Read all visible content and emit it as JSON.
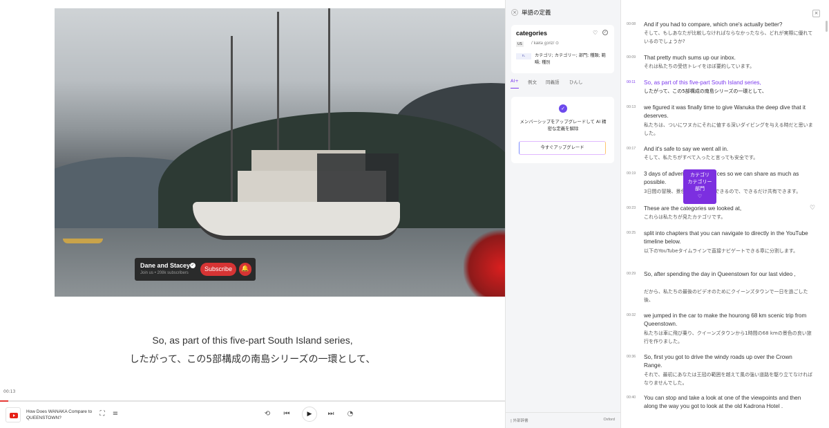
{
  "video": {
    "channel_name": "Dane and Stacey",
    "channel_sub": "Join us • 208k subscribers",
    "subscribe_label": "Subscribe",
    "check_glyph": "✓",
    "bell_glyph": "🔔"
  },
  "captions": {
    "english": "So, as part of this five-part South Island series,",
    "japanese": "したがって、この5部構成の南島シリーズの一環として、"
  },
  "player": {
    "time": "00:13",
    "progress_fraction": 0.016,
    "title": "How Does WANAKA Compare to QUEENSTOWN?",
    "icons": {
      "logo": "youtube-icon",
      "subtitle": "subtitle-icon",
      "add": "add-list-icon",
      "loop": "loop-icon",
      "prev": "skip-previous-icon",
      "play": "play-icon",
      "next": "skip-next-icon",
      "speed": "speed-icon"
    },
    "glyphs": {
      "subtitle": "⛶",
      "add": "≡",
      "loop": "⟲",
      "prev": "⏮",
      "play": "▶",
      "next": "⏭",
      "speed": "◔"
    }
  },
  "definition": {
    "panel_title": "単語の定義",
    "close_glyph": "×",
    "word": "categories",
    "heart_glyph": "♡",
    "check_glyph": "✓",
    "region": "US",
    "pronunciation": "/ˈkætəˌɡɔriz/ ⊙",
    "pos": "n.",
    "meaning": "カテゴリ; カテゴリー; 部門; 種類; 範疇; 種別",
    "tabs": [
      "AI+",
      "例文",
      "同義語",
      "ひんし"
    ],
    "active_tab": "AI+",
    "upgrade_icon_glyph": "✓",
    "upgrade_text": "メンバーシップをアップグレードして AI 精密な定義を解除",
    "upgrade_button": "今すぐアップグレード",
    "footer_left": "| 外部辞書",
    "footer_right": "Oxford"
  },
  "transcript": {
    "close_glyph": "×",
    "popup": {
      "line1": "カテゴリ",
      "line2": "カテゴリー",
      "line3": "部門",
      "heart_glyph": "♡"
    },
    "row_heart_glyph": "♡",
    "segments": [
      {
        "time": "00:08",
        "en": "And if you had to compare, which one's actually better?",
        "ja": "そして、もしあなたが比較しなければならなかったなら、どれが実際に優れているのでしょうか?"
      },
      {
        "time": "00:09",
        "en": "That pretty much sums up our inbox.",
        "ja": "それは私たちの受信トレイをほぼ要約しています。"
      },
      {
        "time": "00:11",
        "en": "So, as part of this five-part South Island series,",
        "ja": "したがって、この5部構成の南島シリーズの一環として、",
        "active": true
      },
      {
        "time": "00:13",
        "en": "we figured it was finally time to give Wanuka the deep dive that it deserves.",
        "ja": "私たちは、ついにワヌカにそれに値する深いダイビングを与える時だと思いました。"
      },
      {
        "time": "00:17",
        "en": "And it's safe to say we went all in.",
        "ja": "そして、私たちがすべて入ったと言っても安全です。"
      },
      {
        "time": "00:19",
        "en": "3 days of adventures, and prices so we can share as much as possible.",
        "ja": "3日間の冒険、景色、価格を共有できるので、できるだけ共有できます。"
      },
      {
        "time": "00:23",
        "en": "These are the categories we looked at,",
        "ja": "これらは私たちが見たカテゴリです。"
      },
      {
        "time": "00:25",
        "en": "split into chapters that you can navigate to directly in the YouTube timeline below.",
        "ja": "以下のYouTubeタイムラインで直接ナビゲートできる章に分割します。"
      },
      {
        "time": "00:29",
        "en": "So, after spending the day in Queenstown for our last video ,",
        "ja": "だから、私たちの最後のビデオのためにクイーンズタウンで一日を過ごした後、"
      },
      {
        "time": "00:32",
        "en": "we jumped in the car to make the hourong 68 km scenic trip from Queenstown.",
        "ja": "私たちは車に飛び乗り、クイーンズタウンから1時間の68 kmの景色の良い旅行を作りました。"
      },
      {
        "time": "00:36",
        "en": "So, first you got to drive the windy roads up over the Crown Range.",
        "ja": "それで、最初にあなたは王冠の範囲を越えて風の強い道路を駆り立てなければなりませんでした。"
      },
      {
        "time": "00:40",
        "en": "You can stop and take a look at one of the viewpoints and then along the way you got to look at the old Kadrona Hotel .",
        "ja": ""
      }
    ]
  }
}
